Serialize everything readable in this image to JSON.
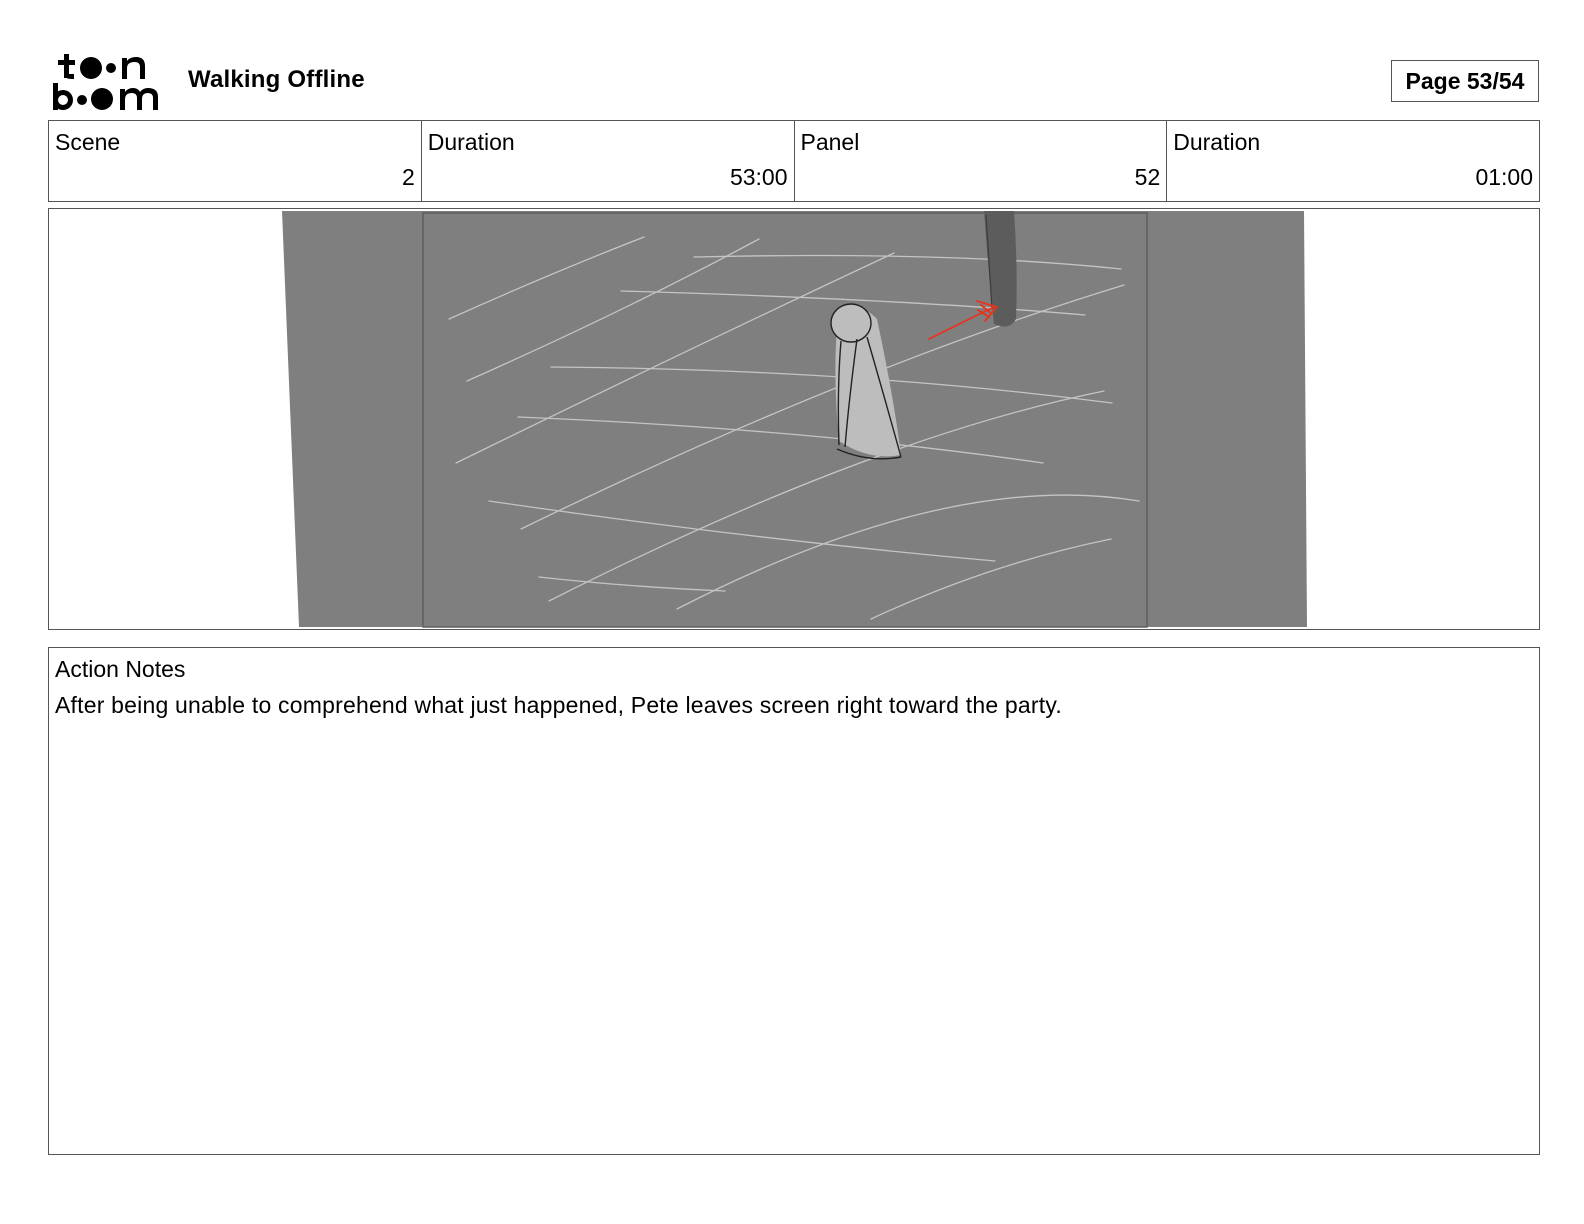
{
  "header": {
    "brand_top": "toon",
    "brand_bottom": "boom",
    "project_title": "Walking Offline",
    "page_indicator": "Page 53/54"
  },
  "info": {
    "scene_label": "Scene",
    "scene_value": "2",
    "scene_duration_label": "Duration",
    "scene_duration_value": "53:00",
    "panel_label": "Panel",
    "panel_value": "52",
    "panel_duration_label": "Duration",
    "panel_duration_value": "01:00"
  },
  "notes": {
    "label": "Action Notes",
    "text": "After being unable to comprehend what just happened, Pete leaves screen right toward the party."
  },
  "colors": {
    "panel_background": "#7f7f7f",
    "sketch_lines": "#c4c4c4",
    "figure_fill": "#bdbdbd",
    "pole": "#5c5c5c",
    "arrow": "#e8341c"
  }
}
